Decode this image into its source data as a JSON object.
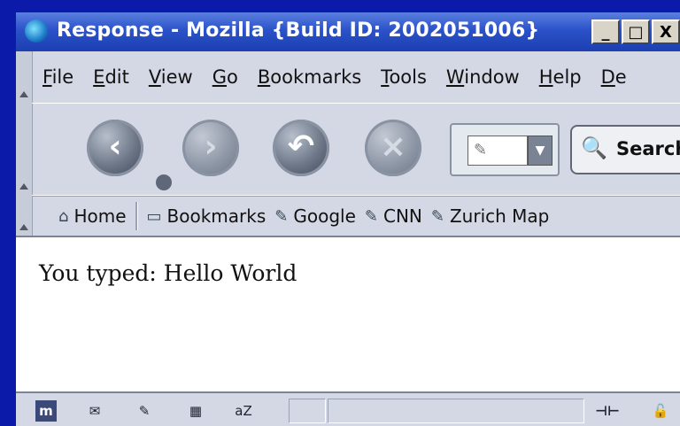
{
  "window": {
    "title": "Response - Mozilla {Build ID: 2002051006}",
    "buttons": {
      "minimize": "_",
      "maximize": "□",
      "close": "X"
    }
  },
  "menu": [
    "File",
    "Edit",
    "View",
    "Go",
    "Bookmarks",
    "Tools",
    "Window",
    "Help",
    "De"
  ],
  "nav": {
    "back": "‹",
    "forward": "›",
    "reload": "↶",
    "stop": "×",
    "url_icon": "✎",
    "url_drop": "▼",
    "search_label": "Search",
    "search_icon": "🔍"
  },
  "personal": {
    "home_label": "Home",
    "bookmarks_label": "Bookmarks",
    "links": [
      "Google",
      "CNN",
      "Zurich Map"
    ]
  },
  "content": {
    "text": "You typed: Hello World"
  },
  "status": {
    "icons": [
      "m",
      "✉",
      "✎",
      "▦",
      "aZ"
    ],
    "right_icons": [
      "⊣⊢",
      "🔓"
    ]
  },
  "colors": {
    "desktop": "#0b1aa8",
    "titlebar": "#2b52c9",
    "chrome": "#d3d8e4"
  }
}
